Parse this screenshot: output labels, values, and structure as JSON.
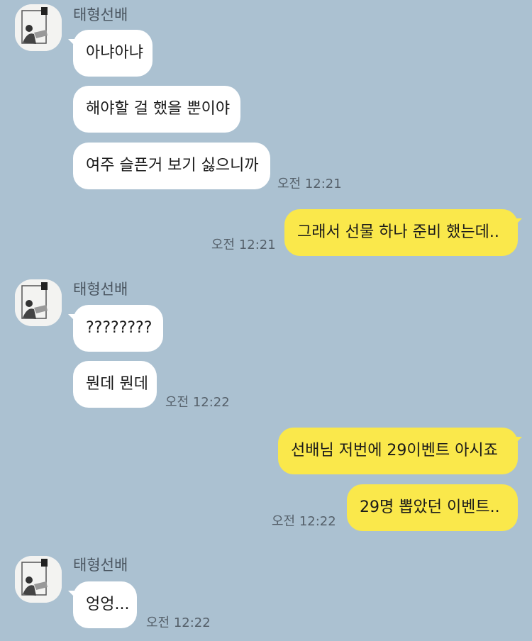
{
  "chat": {
    "sender_name": "태형선배",
    "groups": [
      {
        "sender": "태형선배",
        "messages": [
          "아냐아냐",
          "해야할 걸 했을 뿐이야",
          "여주 슬픈거 보기 싫으니까"
        ],
        "time": "오전 12:21"
      },
      {
        "sender": "me",
        "messages": [
          "그래서 선물 하나 준비 했는데.."
        ],
        "time": "오전 12:21"
      },
      {
        "sender": "태형선배",
        "messages": [
          "????????",
          "뭔데 뭔데"
        ],
        "time": "오전 12:22"
      },
      {
        "sender": "me",
        "messages": [
          "선배님 저번에 29이벤트 아시죠",
          "29명 뽑았던 이벤트.."
        ],
        "time": "오전 12:22"
      },
      {
        "sender": "태형선배",
        "messages": [
          "엉엉..."
        ],
        "time": "오전 12:22"
      }
    ]
  },
  "icons": {
    "avatar": "profile-photo-icon"
  },
  "colors": {
    "background": "#abc1d1",
    "incoming_bubble": "#ffffff",
    "outgoing_bubble": "#fae84b",
    "timestamp": "#55606a"
  }
}
